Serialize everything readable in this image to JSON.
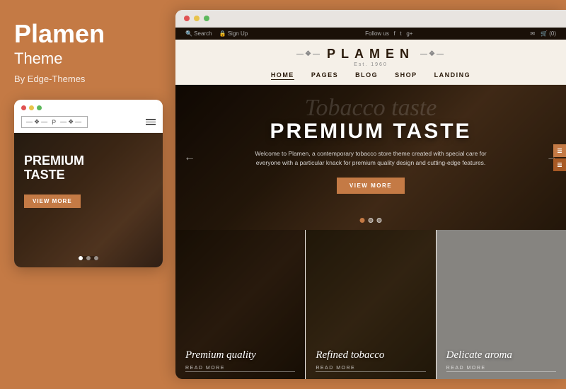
{
  "left": {
    "title": "Plamen",
    "subtitle": "Theme",
    "author": "By Edge-Themes",
    "mobile": {
      "dots": [
        "red",
        "yellow",
        "green"
      ],
      "logo": "—❖— P —❖—",
      "hero_title": "PREMIUM\nTASTE",
      "hero_btn": "VIEW MORE",
      "nav_dots": [
        "active",
        "",
        ""
      ]
    }
  },
  "right": {
    "browser_dots": [
      "red",
      "yellow",
      "green"
    ],
    "topbar": {
      "left_items": [
        "🔍 Search",
        "Sign Up"
      ],
      "center": "Follow us",
      "right_items": [
        "✉",
        "(0)"
      ]
    },
    "logo": "PLAMEN",
    "logo_ornament_left": "—❖—",
    "logo_ornament_right": "—❖—",
    "logo_subtitle": "Est. 1960",
    "nav": [
      {
        "label": "HOME",
        "active": true
      },
      {
        "label": "PAGES",
        "active": false
      },
      {
        "label": "BLOG",
        "active": false
      },
      {
        "label": "SHOP",
        "active": false
      },
      {
        "label": "LANDING",
        "active": false
      }
    ],
    "hero": {
      "script_text": "Tobacco taste",
      "title": "PREMIUM TASTE",
      "description": "Welcome to Plamen, a contemporary tobacco store theme created with special care for everyone with a particular knack for premium quality design and cutting-edge features.",
      "btn_label": "VIEW MORE",
      "dots": [
        true,
        false,
        false
      ]
    },
    "cards": [
      {
        "title": "Premium quality",
        "link": "READ MORE"
      },
      {
        "title": "Refined tobacco",
        "link": "READ MORE"
      },
      {
        "title": "Delicate aroma",
        "link": "READ MORE"
      }
    ]
  }
}
